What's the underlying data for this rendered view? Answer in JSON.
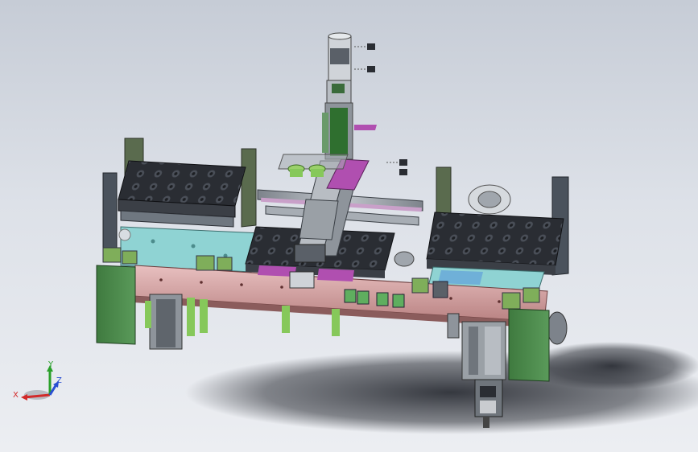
{
  "viewport": {
    "background_top": "#c6ccd6",
    "background_bottom": "#eceef2"
  },
  "model": {
    "frame_color": "#4e8a4e",
    "rail_color": "#d9a6a6",
    "tray_color": "#2a2d33",
    "plate_color": "#8fd3d3",
    "accent_purple": "#b04fb0",
    "gantry_color": "#9aa0a6",
    "cylinder_color": "#86c85a",
    "shadow_color": "#2c2f36"
  },
  "triad": {
    "x_label": "X",
    "y_label": "Y",
    "z_label": "Z",
    "x_color": "#d22a2a",
    "y_color": "#2aa02a",
    "z_color": "#2a4fd2"
  }
}
